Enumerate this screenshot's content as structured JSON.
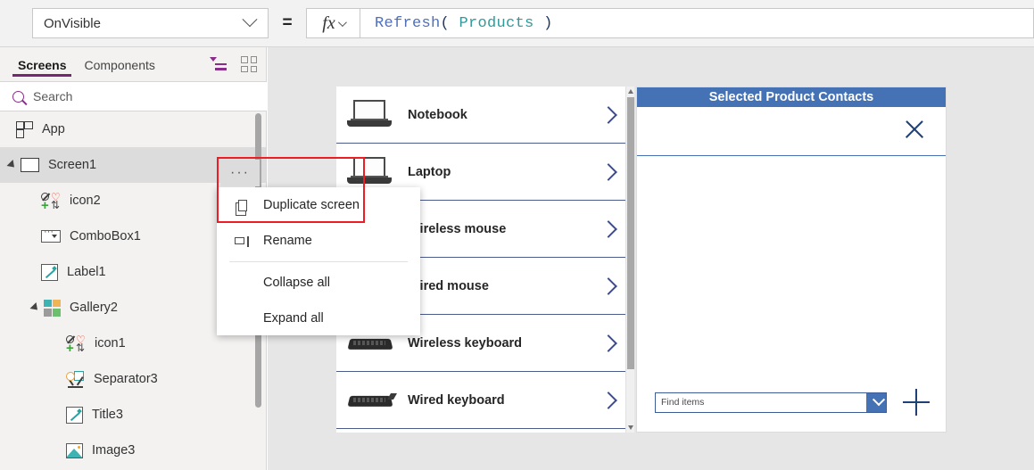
{
  "formula_bar": {
    "property_name": "OnVisible",
    "equals": "=",
    "fx_label": "fx",
    "formula_tokens": {
      "function": "Refresh",
      "open_paren": "(",
      "table": "Products",
      "close_paren": ")"
    },
    "formula_full": "Refresh( Products )"
  },
  "tree_pane": {
    "tabs": [
      {
        "label": "Screens",
        "active": true
      },
      {
        "label": "Components",
        "active": false
      }
    ],
    "view_icons": [
      {
        "name": "tree-view-icon",
        "accent": "#8a2d8a"
      },
      {
        "name": "thumbnail-view-icon",
        "accent": "#8c8c8c"
      }
    ],
    "search": {
      "placeholder": "Search",
      "value": ""
    },
    "items": [
      {
        "label": "App",
        "icon": "app-icon",
        "indent": 0,
        "caret": "none",
        "selected": false
      },
      {
        "label": "Screen1",
        "icon": "screen-icon",
        "indent": 0,
        "caret": "expanded",
        "selected": true
      },
      {
        "label": "icon2",
        "icon": "control-icon",
        "indent": 1,
        "caret": "none",
        "selected": false
      },
      {
        "label": "ComboBox1",
        "icon": "combobox-icon",
        "indent": 1,
        "caret": "none",
        "selected": false
      },
      {
        "label": "Label1",
        "icon": "label-icon",
        "indent": 1,
        "caret": "none",
        "selected": false
      },
      {
        "label": "Gallery2",
        "icon": "gallery-icon",
        "indent": 1,
        "caret": "expanded",
        "selected": false
      },
      {
        "label": "icon1",
        "icon": "control-icon",
        "indent": 2,
        "caret": "none",
        "selected": false
      },
      {
        "label": "Separator3",
        "icon": "separator-icon",
        "indent": 2,
        "caret": "none",
        "selected": false
      },
      {
        "label": "Title3",
        "icon": "label-icon",
        "indent": 2,
        "caret": "none",
        "selected": false
      },
      {
        "label": "Image3",
        "icon": "image-icon",
        "indent": 2,
        "caret": "none",
        "selected": false
      }
    ]
  },
  "context_menu": {
    "ellipsis_label": "···",
    "items": [
      {
        "label": "Duplicate screen",
        "icon": "duplicate-icon",
        "highlighted": true
      },
      {
        "label": "Rename",
        "icon": "rename-icon",
        "highlighted": false
      },
      {
        "label": "Collapse all",
        "icon": "none",
        "highlighted": false
      },
      {
        "label": "Expand all",
        "icon": "none",
        "highlighted": false
      }
    ]
  },
  "canvas": {
    "gallery": {
      "items": [
        {
          "name": "Notebook",
          "thumb": "laptop"
        },
        {
          "name": "Laptop",
          "thumb": "laptop"
        },
        {
          "name": "Wireless mouse",
          "thumb": "mouse"
        },
        {
          "name": "Wired mouse",
          "thumb": "mouse"
        },
        {
          "name": "Wireless keyboard",
          "thumb": "keyboard"
        },
        {
          "name": "Wired keyboard",
          "thumb": "keyboard"
        }
      ]
    },
    "form_panel": {
      "title": "Selected Product Contacts",
      "close_icon": "close-icon",
      "combobox": {
        "placeholder": "Find items",
        "value": ""
      },
      "add_icon": "plus-icon"
    }
  },
  "colors": {
    "accent_purple": "#742774",
    "panel_blue": "#4472b4",
    "highlight_red": "#ee1c25",
    "token_function": "#4f6fbb",
    "token_table": "#2f9a9a",
    "token_paren": "#1f3864"
  }
}
